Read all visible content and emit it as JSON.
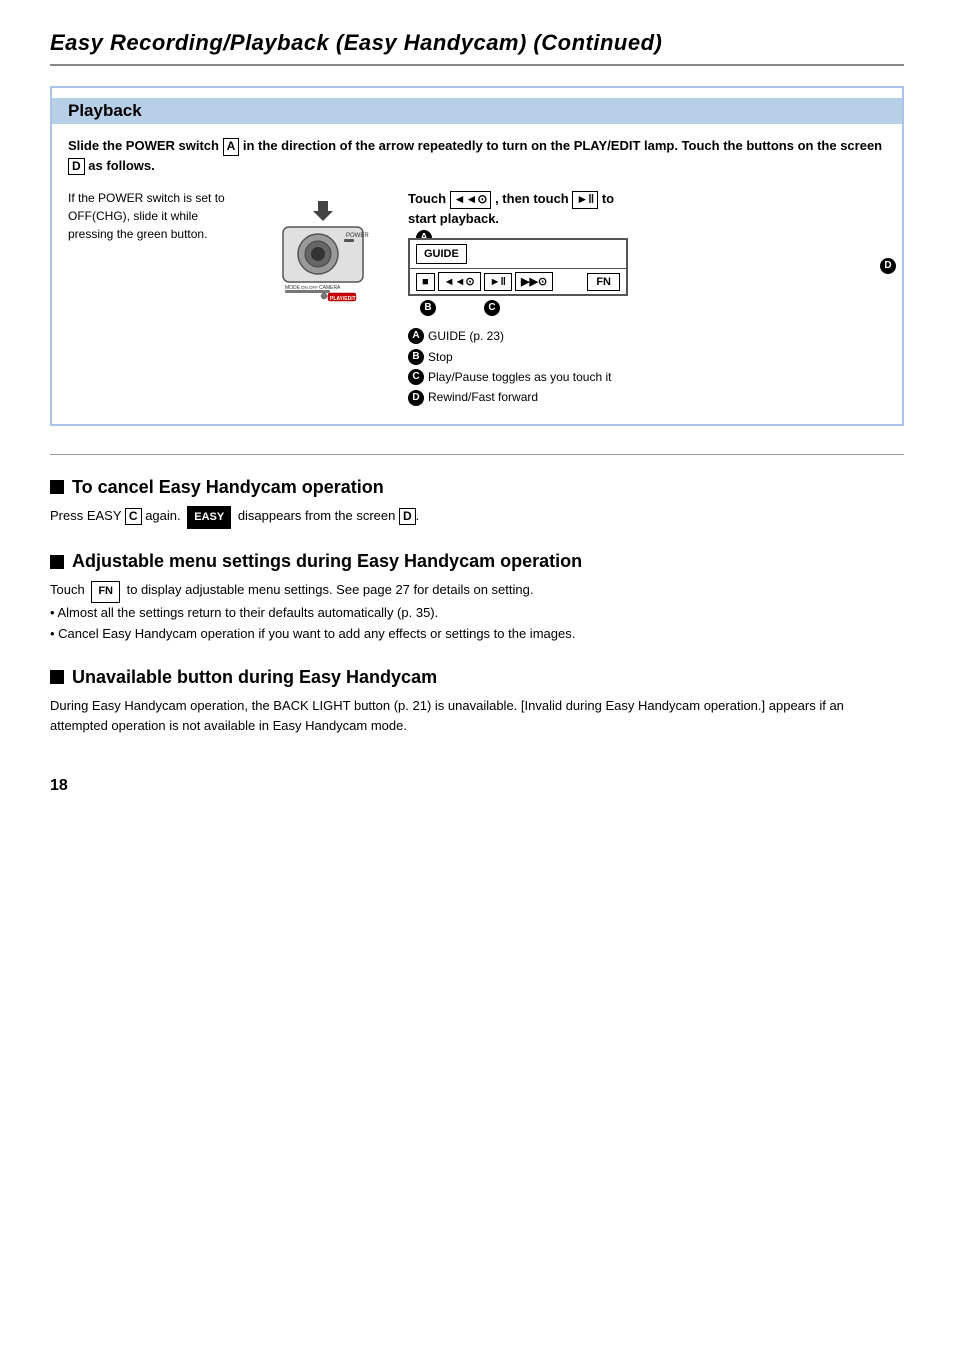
{
  "page": {
    "title": "Easy Recording/Playback (Easy Handycam) (Continued)",
    "page_number": "18"
  },
  "playback": {
    "header": "Playback",
    "instruction_part1": "Slide the POWER switch",
    "instruction_box_a": "A",
    "instruction_part2": "in the direction of the arrow repeatedly to turn on the PLAY/EDIT lamp. Touch the buttons on the screen",
    "instruction_box_d": "D",
    "instruction_part3": "as follows.",
    "left_note": "If the POWER switch is set to OFF(CHG), slide it while pressing the green button.",
    "touch_instruction_part1": "Touch",
    "touch_rew_icon": "◄◄⊙",
    "touch_instruction_part2": ", then touch",
    "touch_play_icon": "► ‖",
    "touch_instruction_part3": "to start playback.",
    "screen_labels": {
      "guide_btn": "GUIDE",
      "fn_btn": "FN",
      "stop_btn": "■",
      "rew_btn": "◄◄⊙",
      "play_btn": "►‖",
      "ff_btn": "▶▶⊙",
      "label_a": "A",
      "label_b": "B",
      "label_c": "C",
      "label_d": "D"
    },
    "legend": [
      {
        "key": "A",
        "text": "GUIDE (p. 23)"
      },
      {
        "key": "B",
        "text": "Stop"
      },
      {
        "key": "C",
        "text": "Play/Pause toggles as you touch it"
      },
      {
        "key": "D",
        "text": "Rewind/Fast forward"
      }
    ]
  },
  "sections": [
    {
      "id": "cancel",
      "heading": "To cancel Easy Handycam operation",
      "body_parts": [
        {
          "type": "text",
          "text": "Press EASY "
        },
        {
          "type": "box",
          "text": "C"
        },
        {
          "type": "text",
          "text": " again. "
        },
        {
          "type": "easy_badge",
          "text": "EASY"
        },
        {
          "type": "text",
          "text": " disappears from the screen "
        },
        {
          "type": "box",
          "text": "D"
        },
        {
          "type": "text",
          "text": "."
        }
      ]
    },
    {
      "id": "adjustable",
      "heading": "Adjustable menu settings during Easy Handycam operation",
      "body_line1_pre": "Touch ",
      "body_line1_fn": "FN",
      "body_line1_post": " to display adjustable menu settings. See page 27 for details on setting.",
      "bullets": [
        "Almost all the settings return to their defaults automatically (p. 35).",
        "Cancel Easy Handycam operation if you want to add any effects or settings to the images."
      ]
    },
    {
      "id": "unavailable",
      "heading": "Unavailable button during Easy Handycam",
      "body": "During Easy Handycam operation, the BACK LIGHT button (p. 21) is unavailable. [Invalid during Easy Handycam operation.] appears if an attempted operation is not available in Easy Handycam mode."
    }
  ]
}
